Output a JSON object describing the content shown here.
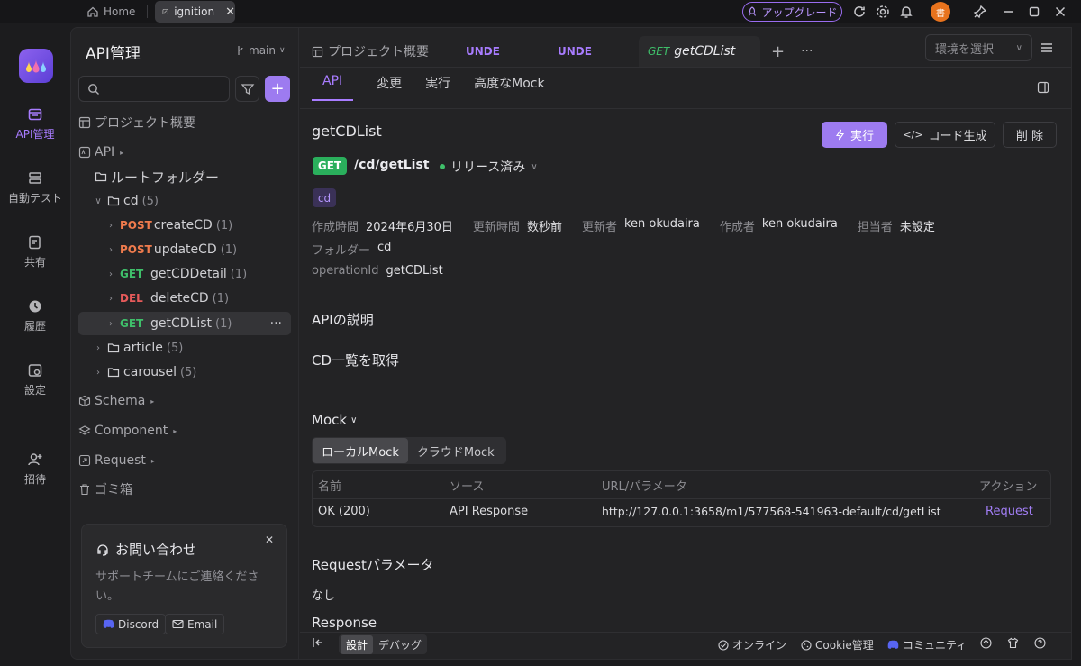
{
  "titlebar": {
    "home_label": "Home",
    "project_tab": "ignition",
    "upgrade_label": "アップグレード",
    "avatar_text": "書"
  },
  "rail": [
    {
      "label": "API管理",
      "active": true
    },
    {
      "label": "自動テスト"
    },
    {
      "label": "共有"
    },
    {
      "label": "履歴"
    },
    {
      "label": "設定"
    },
    {
      "label": "招待"
    }
  ],
  "sidebar": {
    "title": "API管理",
    "branch": "main",
    "project_overview": "プロジェクト概要",
    "api_section": "API",
    "root_folder": "ルートフォルダー",
    "folders": {
      "cd": {
        "name": "cd",
        "count": "(5)"
      },
      "article": {
        "name": "article",
        "count": "(5)"
      },
      "carousel": {
        "name": "carousel",
        "count": "(5)"
      }
    },
    "endpoints": [
      {
        "method": "POST",
        "name": "createCD",
        "count": "(1)"
      },
      {
        "method": "POST",
        "name": "updateCD",
        "count": "(1)"
      },
      {
        "method": "GET",
        "name": "getCDDetail",
        "count": "(1)"
      },
      {
        "method": "DEL",
        "name": "deleteCD",
        "count": "(1)"
      },
      {
        "method": "GET",
        "name": "getCDList",
        "count": "(1)"
      }
    ],
    "schema": "Schema",
    "component": "Component",
    "request": "Request",
    "trash": "ゴミ箱",
    "support": {
      "title": "お問い合わせ",
      "text": "サポートチームにご連絡ください。",
      "discord": "Discord",
      "email": "Email"
    }
  },
  "tabs": [
    {
      "label": "プロジェクト概要"
    },
    {
      "label": "UNDE"
    },
    {
      "label": "UNDE"
    },
    {
      "method": "GET",
      "label": "getCDList"
    }
  ],
  "env_select": {
    "placeholder": "環境を選択"
  },
  "subtabs": [
    "API",
    "変更",
    "実行",
    "高度なMock"
  ],
  "api": {
    "name": "getCDList",
    "method": "GET",
    "path": "/cd/getList",
    "status": "リリース済み",
    "tag": "cd",
    "run_label": "実行",
    "codegen_label": "コード生成",
    "delete_label": "削 除",
    "meta": {
      "created_label": "作成時間",
      "created": "2024年6月30日",
      "updated_label": "更新時間",
      "updated": "数秒前",
      "updater_label": "更新者",
      "updater": "ken okudaira",
      "author_label": "作成者",
      "author": "ken okudaira",
      "assignee_label": "担当者",
      "assignee": "未設定",
      "folder_label": "フォルダー",
      "folder": "cd",
      "opid_label": "operationId",
      "opid": "getCDList"
    },
    "desc_title": "APIの説明",
    "desc": "CD一覧を取得"
  },
  "mock": {
    "title": "Mock",
    "tabs": [
      "ローカルMock",
      "クラウドMock"
    ],
    "headers": [
      "名前",
      "ソース",
      "URL/パラメータ",
      "アクション"
    ],
    "row": {
      "name": "OK (200)",
      "source": "API Response",
      "url": "http://127.0.0.1:3658/m1/577568-541963-default/cd/getList",
      "action": "Request"
    }
  },
  "request_params": {
    "title": "Requestパラメータ",
    "value": "なし"
  },
  "response_title": "Response",
  "bottombar": {
    "design": "設計",
    "debug": "デバッグ",
    "online": "オンライン",
    "cookie": "Cookie管理",
    "community": "コミュニティ"
  },
  "colors": {
    "accent": "#9d7bf0",
    "get": "#3fbf6a",
    "post": "#ef7b4d",
    "del": "#e65a5a"
  }
}
